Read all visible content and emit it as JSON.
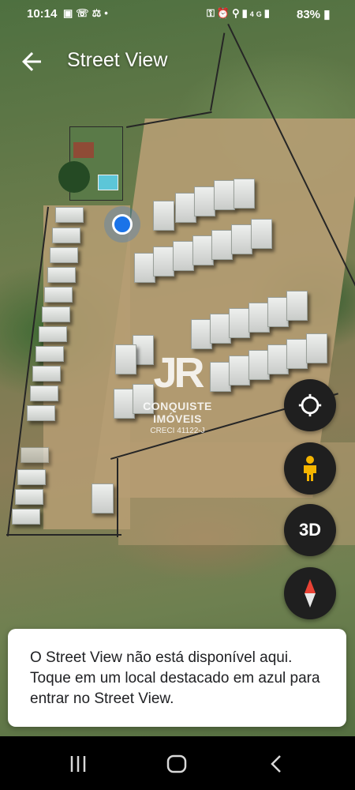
{
  "status_bar": {
    "time": "10:14",
    "left_icons": [
      "gallery-icon",
      "whatsapp-icon",
      "accessibility-icon",
      "dot-icon"
    ],
    "right_icons": [
      "key-icon",
      "alarm-icon",
      "location-icon",
      "signal-icon",
      "4g-icon",
      "signal-icon"
    ],
    "battery": "83%"
  },
  "header": {
    "title": "Street View",
    "back_icon": "arrow-back-icon"
  },
  "watermark": {
    "logo_text": "JR",
    "name": "CONQUISTE IMÓVEIS",
    "creci": "CRECI 41122-J"
  },
  "controls": {
    "location_icon": "my-location-icon",
    "pegman_icon": "pegman-icon",
    "toggle_3d": "3D",
    "compass_icon": "compass-icon"
  },
  "toast": {
    "message": "O Street View não está disponível aqui. Toque em um local destacado em azul para entrar no Street View."
  },
  "nav_bar": {
    "recent_icon": "recent-apps-icon",
    "home_icon": "home-icon",
    "back_icon": "back-icon"
  },
  "colors": {
    "accent_blue": "#1a73e8",
    "fab_bg": "#1f1f1f",
    "pegman": "#f4b400"
  }
}
